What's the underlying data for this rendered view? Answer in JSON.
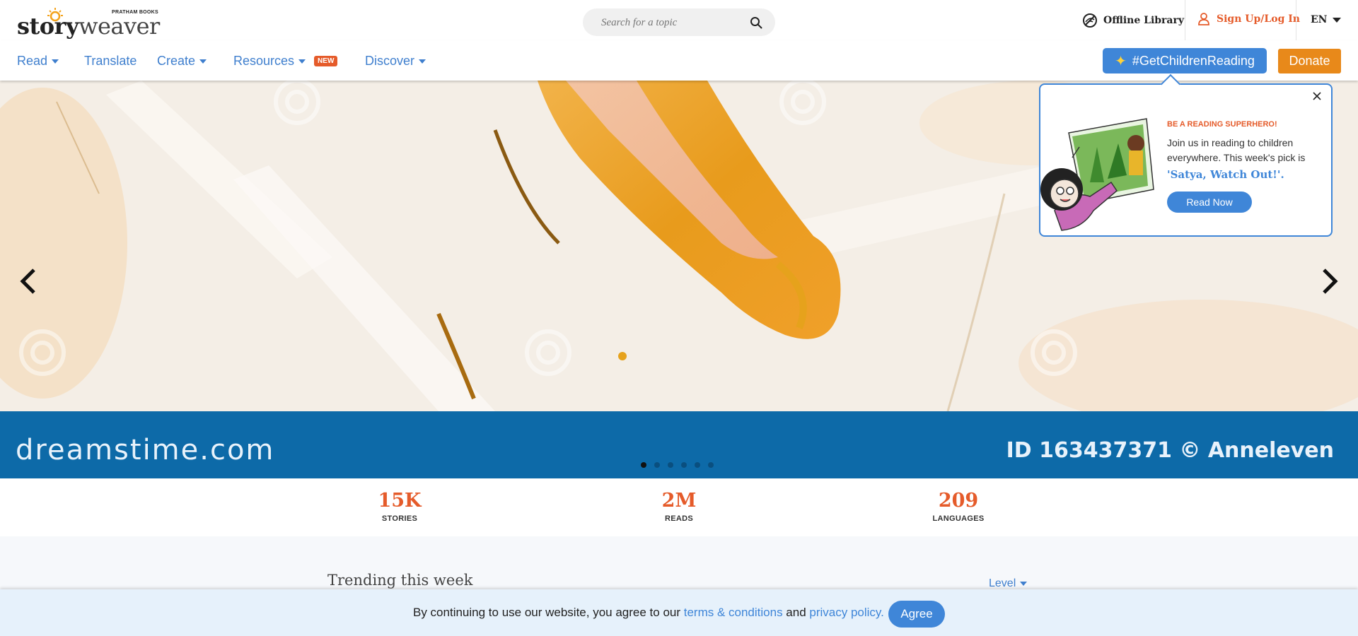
{
  "header": {
    "logo_story": "story",
    "logo_weaver": "weaver",
    "logo_publisher": "PRATHAM BOOKS",
    "search_placeholder": "Search for a topic",
    "offline_library": "Offline Library",
    "signup_login": "Sign Up/Log In",
    "language": "EN"
  },
  "nav": {
    "items": [
      {
        "label": "Read"
      },
      {
        "label": "Translate"
      },
      {
        "label": "Create"
      },
      {
        "label": "Resources"
      },
      {
        "label": "Discover"
      }
    ],
    "new_badge": "NEW",
    "get_children_reading": "#GetChildrenReading",
    "donate": "Donate"
  },
  "hero": {
    "watermark_brand": "dreamstime.com",
    "watermark_id": "ID 163437371 © Anneleven",
    "slide_count": 6,
    "active_slide": 1
  },
  "popover": {
    "kicker": "BE A READING SUPERHERO!",
    "body": "Join us in reading to children everywhere. This week's pick is",
    "pick": "'Satya, Watch Out!'.",
    "read_now": "Read Now"
  },
  "stats": [
    {
      "value": "15K",
      "label": "STORIES"
    },
    {
      "value": "2M",
      "label": "READS"
    },
    {
      "value": "209",
      "label": "LANGUAGES"
    }
  ],
  "trending": {
    "title": "Trending this week",
    "level_filter": "Level"
  },
  "cookie": {
    "text_before": "By continuing to use our website, you agree to our ",
    "terms_link": "terms & conditions",
    "text_middle": " and ",
    "privacy_link": "privacy policy.",
    "agree": "Agree"
  },
  "colors": {
    "accent_blue": "#3f86d8",
    "accent_orange": "#e55b2a",
    "donate_orange": "#e8891a",
    "watermark_band": "#0d6aa8"
  }
}
